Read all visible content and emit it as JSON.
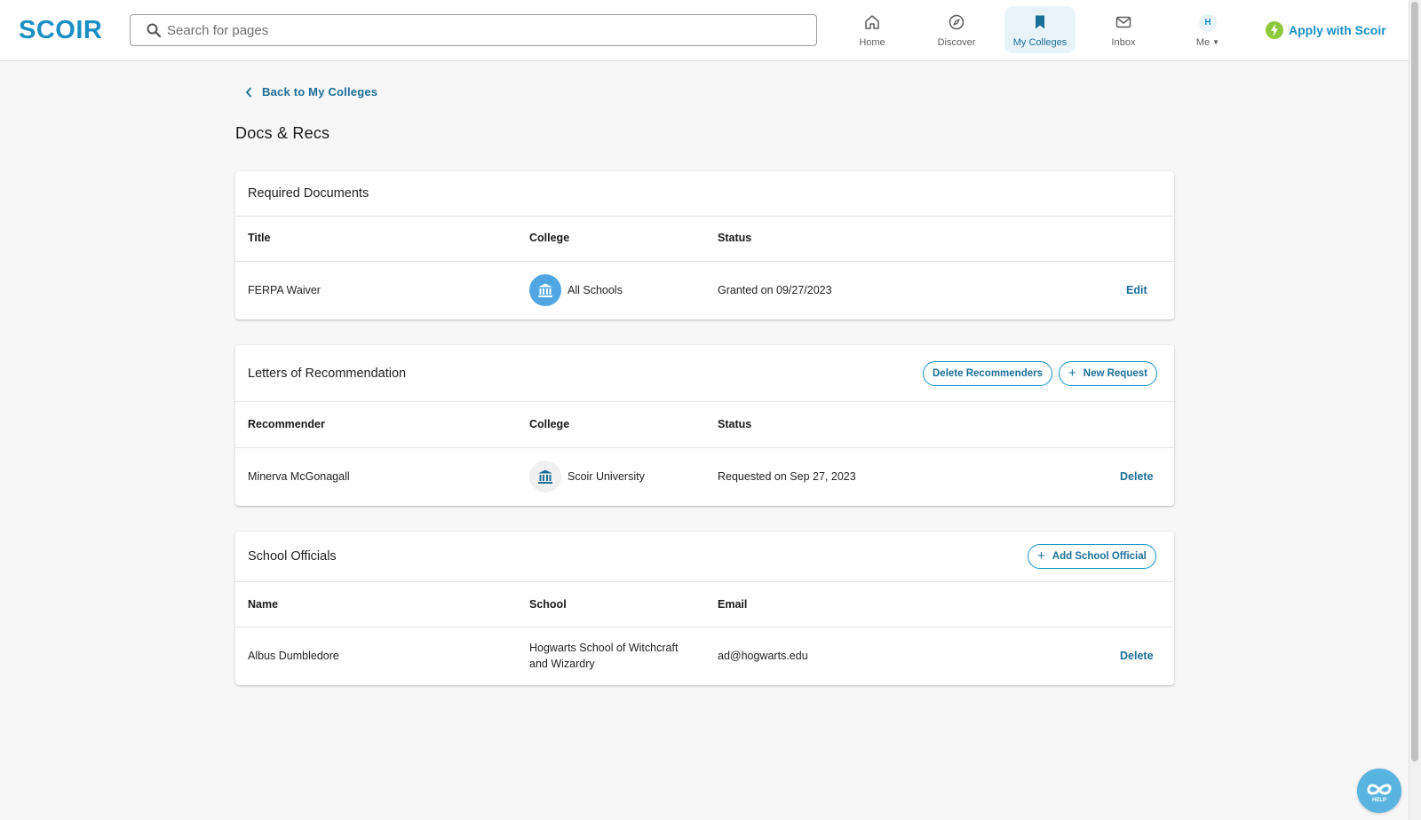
{
  "header": {
    "logo": "SCOIR",
    "search_placeholder": "Search for pages",
    "nav": [
      {
        "label": "Home",
        "icon": "home-icon"
      },
      {
        "label": "Discover",
        "icon": "compass-icon"
      },
      {
        "label": "My Colleges",
        "icon": "bookmark-icon",
        "active": true
      },
      {
        "label": "Inbox",
        "icon": "envelope-icon"
      },
      {
        "label": "Me",
        "icon": "avatar",
        "initial": "H"
      }
    ],
    "apply_label": "Apply with Scoir"
  },
  "back_label": "Back to My Colleges",
  "page_title": "Docs & Recs",
  "required_documents": {
    "title": "Required Documents",
    "columns": [
      "Title",
      "College",
      "Status"
    ],
    "rows": [
      {
        "title": "FERPA Waiver",
        "college": "All Schools",
        "status": "Granted on 09/27/2023",
        "action": "Edit"
      }
    ]
  },
  "letters": {
    "title": "Letters of Recommendation",
    "delete_label": "Delete Recommenders",
    "new_label": "New Request",
    "columns": [
      "Recommender",
      "College",
      "Status"
    ],
    "rows": [
      {
        "recommender": "Minerva McGonagall",
        "college": "Scoir University",
        "status": "Requested on Sep 27, 2023",
        "action": "Delete"
      }
    ]
  },
  "officials": {
    "title": "School Officials",
    "add_label": "Add School Official",
    "columns": [
      "Name",
      "School",
      "Email"
    ],
    "rows": [
      {
        "name": "Albus Dumbledore",
        "school_line1": "Hogwarts School of Witchcraft",
        "school_line2": "and Wizardry",
        "email": "ad@hogwarts.edu",
        "action": "Delete"
      }
    ]
  },
  "help_label": "HELP",
  "colors": {
    "brand": "#1a8fc4",
    "link": "#1a6e96",
    "nav_active_bg": "#e8f3f9",
    "apply_bolt": "#8fc83c",
    "badge_active": "#4fa6e3",
    "badge_muted": "#f0f0f0"
  }
}
